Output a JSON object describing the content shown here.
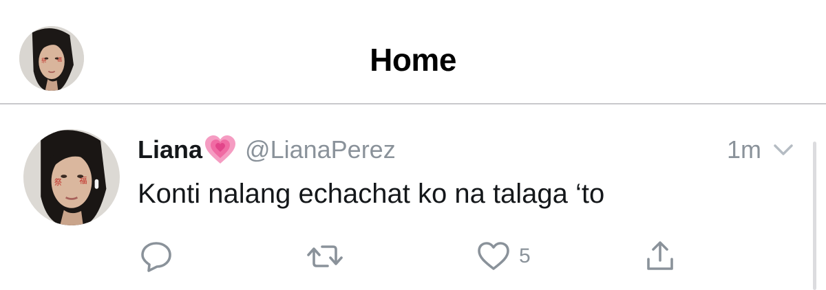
{
  "header": {
    "title": "Home",
    "avatar_icon": "profile-avatar-icon"
  },
  "tweet": {
    "display_name": "Liana",
    "name_emoji": "growing-heart-icon",
    "handle": "@LianaPerez",
    "time": "1m",
    "text": "Konti nalang echachat ko na talaga ‘to",
    "actions": {
      "reply_icon": "reply-icon",
      "retweet_icon": "retweet-icon",
      "like_icon": "heart-icon",
      "like_count": "5",
      "share_icon": "share-icon"
    },
    "menu_icon": "chevron-down-icon"
  },
  "colors": {
    "text_primary": "#14171a",
    "text_secondary": "#8a929a",
    "divider": "#c8c8cc",
    "emoji_pink": "#f57fb0"
  }
}
